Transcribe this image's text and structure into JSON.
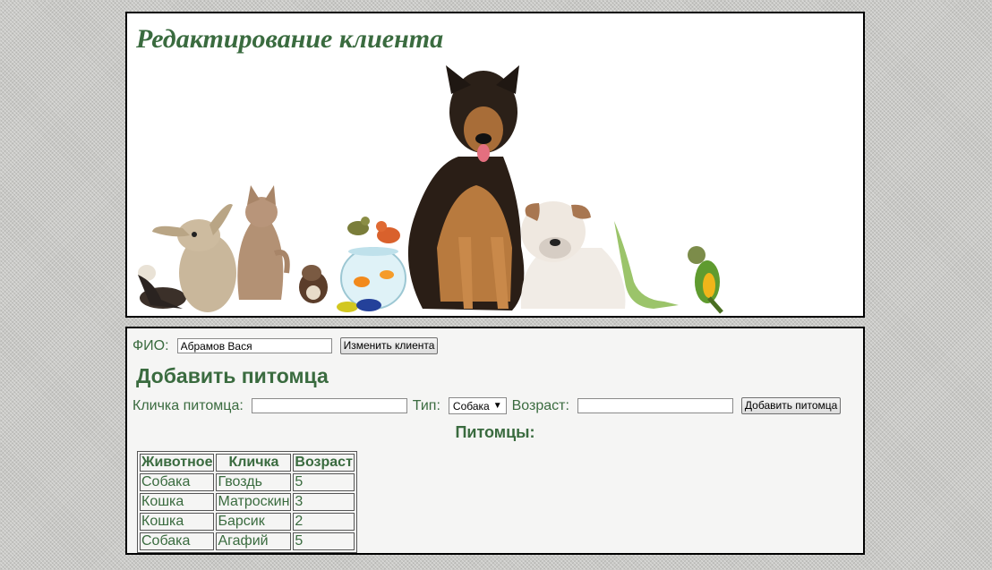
{
  "header": {
    "title": "Редактирование клиента",
    "image_icon": "pets-group-banner"
  },
  "client": {
    "fio_label": "ФИО:",
    "fio_value": "Абрамов Вася",
    "update_button": "Изменить клиента"
  },
  "add_pet": {
    "heading": "Добавить питомца",
    "name_label": "Кличка питомца:",
    "name_value": "",
    "type_label": "Тип:",
    "type_selected": "Собака",
    "age_label": "Возраст:",
    "age_value": "",
    "submit_button": "Добавить питомца"
  },
  "pets": {
    "heading": "Питомцы:",
    "columns": [
      "Животное",
      "Кличка",
      "Возраст"
    ],
    "rows": [
      [
        "Собака",
        "Гвоздь",
        "5"
      ],
      [
        "Кошка",
        "Матроскин",
        "3"
      ],
      [
        "Кошка",
        "Барсик",
        "2"
      ],
      [
        "Собака",
        "Агафий",
        "5"
      ]
    ]
  },
  "colors": {
    "accent_green": "#3a6b3f"
  }
}
